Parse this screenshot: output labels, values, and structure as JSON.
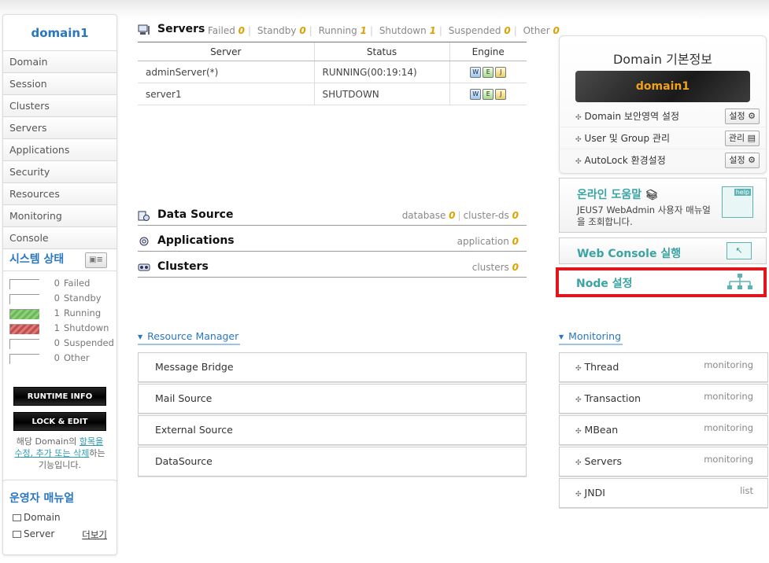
{
  "sidebar": {
    "domain_title": "domain1",
    "nav": [
      "Domain",
      "Session",
      "Clusters",
      "Servers",
      "Applications",
      "Security",
      "Resources",
      "Monitoring",
      "Console"
    ],
    "system_status": {
      "title": "시스템 상태",
      "rows": [
        {
          "count": "0",
          "label": "Failed",
          "state": "failed",
          "fraction": 0
        },
        {
          "count": "0",
          "label": "Standby",
          "state": "standby",
          "fraction": 0
        },
        {
          "count": "1",
          "label": "Running",
          "state": "running",
          "fraction": 1
        },
        {
          "count": "1",
          "label": "Shutdown",
          "state": "shutdown",
          "fraction": 1
        },
        {
          "count": "0",
          "label": "Suspended",
          "state": "suspended",
          "fraction": 0
        },
        {
          "count": "0",
          "label": "Other",
          "state": "other",
          "fraction": 0
        }
      ]
    },
    "runtime_info_label": "RUNTIME INFO",
    "lock_edit_label": "LOCK & EDIT",
    "lock_note_pre": "해당 Domain의 ",
    "lock_note_link": "항목을 수정, 추가 또는 삭제",
    "lock_note_post": "하는 기능입니다."
  },
  "manual": {
    "title": "운영자 매뉴얼",
    "items": [
      "Domain",
      "Server"
    ],
    "more": "더보기"
  },
  "servers": {
    "title": "Servers",
    "counts": [
      {
        "label": "Failed",
        "value": "0"
      },
      {
        "label": "Standby",
        "value": "0"
      },
      {
        "label": "Running",
        "value": "1"
      },
      {
        "label": "Shutdown",
        "value": "1"
      },
      {
        "label": "Suspended",
        "value": "0"
      },
      {
        "label": "Other",
        "value": "0"
      }
    ],
    "columns": [
      "Server",
      "Status",
      "Engine"
    ],
    "rows": [
      {
        "name": "adminServer(*)",
        "status": "RUNNING(00:19:14)"
      },
      {
        "name": "server1",
        "status": "SHUTDOWN"
      }
    ]
  },
  "data_source": {
    "title": "Data Source",
    "database_label": "database",
    "database_count": "0",
    "cluster_label": "cluster-ds",
    "cluster_count": "0"
  },
  "applications": {
    "title": "Applications",
    "label": "application",
    "count": "0"
  },
  "clusters": {
    "title": "Clusters",
    "label": "clusters",
    "count": "0"
  },
  "resource_manager": {
    "title": "Resource Manager",
    "items": [
      "Message Bridge",
      "Mail Source",
      "External Source",
      "DataSource"
    ]
  },
  "domain_info": {
    "title": "Domain 기본정보",
    "domain_name": "domain1",
    "rows": [
      {
        "label": "Domain 보안영역 설정",
        "button": "설정"
      },
      {
        "label": "User 및 Group 관리",
        "button": "관리"
      },
      {
        "label": "AutoLock 환경설정",
        "button": "설정"
      }
    ]
  },
  "help": {
    "title": "온라인 도움말",
    "desc": "JEUS7 WebAdmin 사용자 매뉴얼을 조회합니다.",
    "icon_tag": "help"
  },
  "web_console": {
    "title": "Web Console 실행"
  },
  "node": {
    "title": "Node 설정"
  },
  "monitoring": {
    "title": "Monitoring",
    "items": [
      {
        "label": "Thread",
        "tag": "monitoring"
      },
      {
        "label": "Transaction",
        "tag": "monitoring"
      },
      {
        "label": "MBean",
        "tag": "monitoring"
      },
      {
        "label": "Servers",
        "tag": "monitoring"
      },
      {
        "label": "JNDI",
        "tag": "list"
      }
    ]
  },
  "colors": {
    "accent": "#2a77c0",
    "highlight_border": "#e0161e",
    "count_color": "#e0a100",
    "teal": "#3aa3a3"
  }
}
